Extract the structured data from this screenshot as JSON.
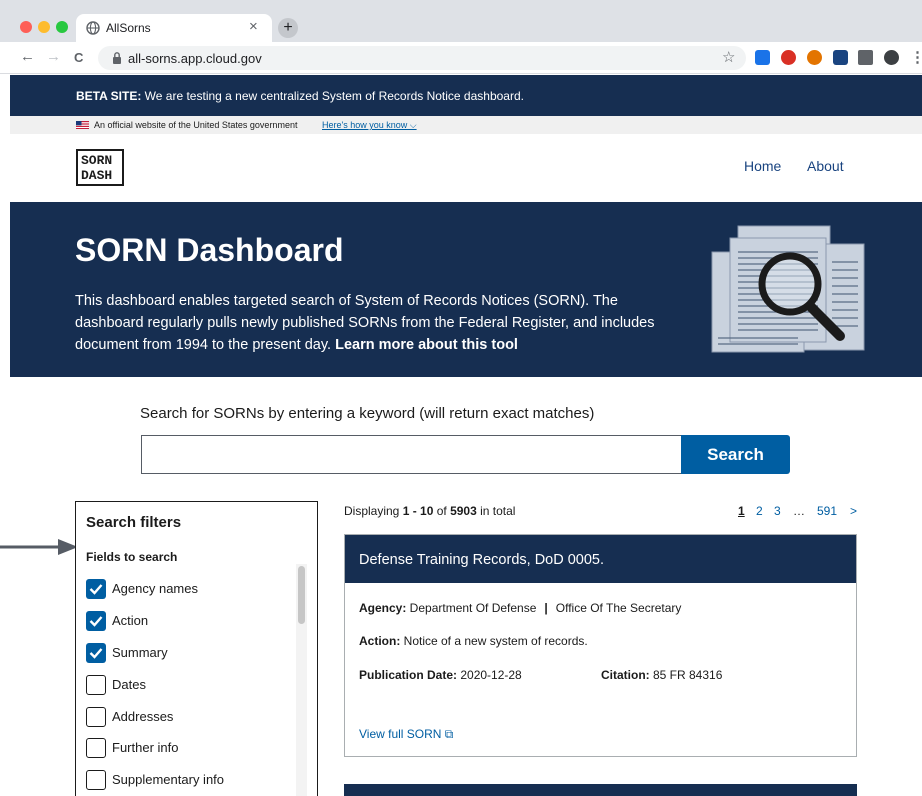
{
  "browser": {
    "tab_title": "AllSorns",
    "tab_close": "×",
    "new_tab": "+",
    "url": "all-sorns.app.cloud.gov",
    "back": "←",
    "forward": "→",
    "reload": "C",
    "bookmark": "☆"
  },
  "beta_banner": {
    "label": "BETA SITE:",
    "text": " We are testing a new centralized System of Records Notice dashboard."
  },
  "gov_banner": {
    "text": "An official website of the United States government",
    "link": "Here's how you know ⌵"
  },
  "header": {
    "logo_line1": "SORN",
    "logo_line2": "DASH",
    "nav": {
      "home": "Home",
      "about": "About"
    }
  },
  "hero": {
    "title": "SORN Dashboard",
    "description": "This dashboard enables targeted search of System of Records Notices (SORN). The dashboard regularly pulls newly published SORNs from the Federal Register, and includes document from 1994 to the present day. ",
    "link": "Learn more about this tool"
  },
  "search": {
    "label": "Search for SORNs by entering a keyword (will return exact matches)",
    "value": "",
    "button": "Search"
  },
  "filters": {
    "title": "Search filters",
    "fields_title": "Fields to search",
    "fields": [
      {
        "label": "Agency names",
        "checked": true
      },
      {
        "label": "Action",
        "checked": true
      },
      {
        "label": "Summary",
        "checked": true
      },
      {
        "label": "Dates",
        "checked": false
      },
      {
        "label": "Addresses",
        "checked": false
      },
      {
        "label": "Further info",
        "checked": false
      },
      {
        "label": "Supplementary info",
        "checked": false
      }
    ]
  },
  "results": {
    "prefix": "Displaying ",
    "range": "1 - 10",
    "of": " of ",
    "total": "5903",
    "suffix": " in total",
    "pager": {
      "p1": "1",
      "p2": "2",
      "p3": "3",
      "ellipsis": "…",
      "last": "591",
      "next": ">"
    },
    "card": {
      "title": "Defense Training Records, DoD 0005.",
      "agency_label": "Agency:",
      "agency": " Department Of Defense",
      "separator": "|",
      "sub_agency": "Office Of The Secretary",
      "action_label": "Action:",
      "action": " Notice of a new system of records.",
      "pubdate_label": "Publication Date:",
      "pubdate": " 2020-12-28",
      "citation_label": "Citation:",
      "citation": " 85 FR 84316",
      "link": "View full SORN ⧉"
    }
  },
  "colors": {
    "navy": "#162e51",
    "primary": "#005ea2",
    "link": "#1a4480"
  }
}
